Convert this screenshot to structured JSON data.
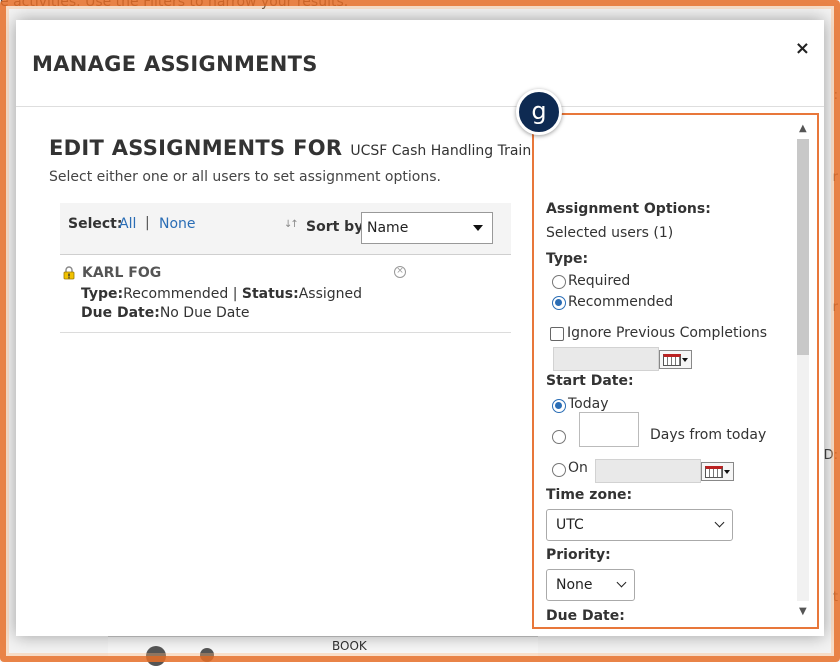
{
  "background": {
    "top_text": "e activities. Use the Filters to narrow your results.",
    "bottom_text": "BOOK",
    "right_fragments": [
      ":",
      "r",
      "E:",
      "D:",
      "t"
    ]
  },
  "modal": {
    "title": "MANAGE ASSIGNMENTS",
    "close_glyph": "×"
  },
  "edit": {
    "heading": "EDIT ASSIGNMENTS FOR",
    "course": "UCSF Cash Handling Training",
    "subtitle": "Select either one or all users to set assignment options."
  },
  "selectBar": {
    "select_label": "Select:",
    "all_link": "All",
    "separator": "|",
    "none_link": "None",
    "sort_icon": "↓↑",
    "sort_label": "Sort by:",
    "sort_value": "Name"
  },
  "user": {
    "name": "KARL FOG",
    "type_label": "Type:",
    "type_value": "Recommended",
    "status_sep": " | ",
    "status_label": "Status:",
    "status_value": "Assigned",
    "due_label": "Due Date:",
    "due_value": "No Due Date",
    "remove_glyph": "×"
  },
  "badge": "g",
  "options": {
    "heading": "Assignment Options:",
    "selected_users": "Selected users (1)",
    "type_heading": "Type:",
    "type_options": [
      "Required",
      "Recommended"
    ],
    "type_selected": "Recommended",
    "ignore_label": "Ignore Previous Completions",
    "ignore_checked": false,
    "start_date_heading": "Start Date:",
    "start_today": "Today",
    "start_days_suffix": "Days from today",
    "start_on": "On",
    "start_selected": "Today",
    "timezone_heading": "Time zone:",
    "timezone_value": "UTC",
    "priority_heading": "Priority:",
    "priority_value": "None",
    "due_date_heading": "Due Date:"
  },
  "colors": {
    "accent_link": "#2a6db5",
    "highlight_border": "#e8773a",
    "badge_bg": "#0e2a52"
  }
}
